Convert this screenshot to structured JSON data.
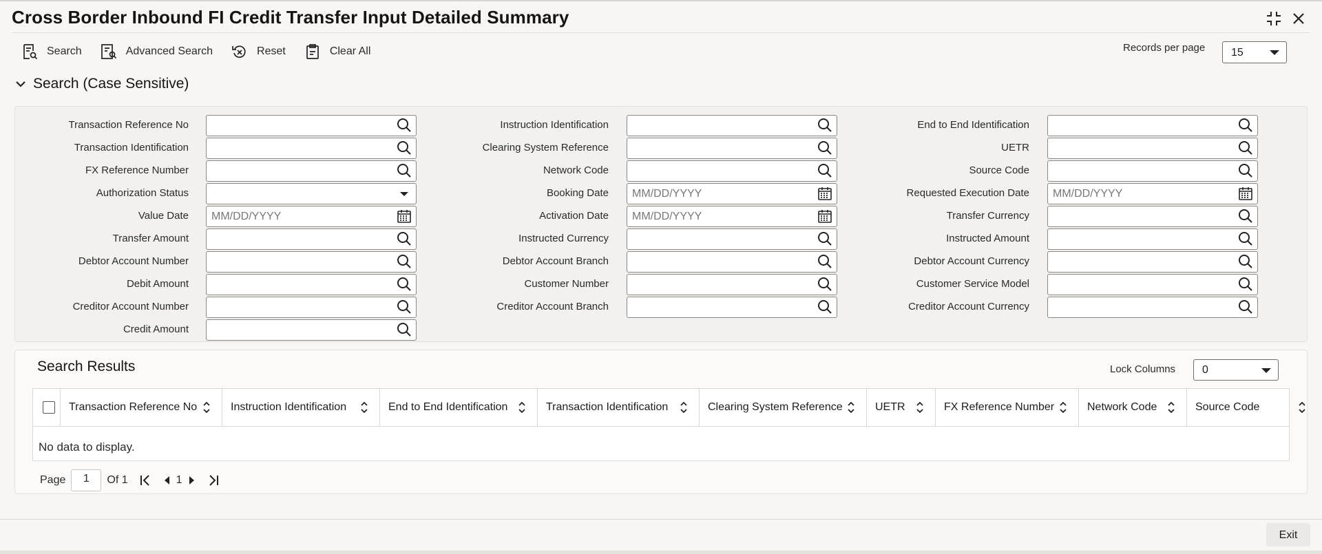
{
  "title": "Cross Border Inbound FI Credit Transfer Input Detailed Summary",
  "toolbar": {
    "search": "Search",
    "advanced_search": "Advanced Search",
    "reset": "Reset",
    "clear_all": "Clear All"
  },
  "records_per_page": {
    "label": "Records per page",
    "value": "15"
  },
  "search_section": {
    "title": "Search (Case Sensitive)"
  },
  "fields": {
    "col1": [
      {
        "label": "Transaction Reference No",
        "value": "",
        "placeholder": "",
        "icon": "search-icon"
      },
      {
        "label": "Transaction Identification",
        "value": "",
        "placeholder": "",
        "icon": "search-icon"
      },
      {
        "label": "FX Reference Number",
        "value": "",
        "placeholder": "",
        "icon": "search-icon"
      },
      {
        "label": "Authorization Status",
        "value": "",
        "placeholder": "",
        "icon": "dropdown-caret-icon"
      },
      {
        "label": "Value Date",
        "value": "",
        "placeholder": "MM/DD/YYYY",
        "icon": "calendar-icon"
      },
      {
        "label": "Transfer Amount",
        "value": "",
        "placeholder": "",
        "icon": "search-icon"
      },
      {
        "label": "Debtor Account Number",
        "value": "",
        "placeholder": "",
        "icon": "search-icon"
      },
      {
        "label": "Debit Amount",
        "value": "",
        "placeholder": "",
        "icon": "search-icon"
      },
      {
        "label": "Creditor Account Number",
        "value": "",
        "placeholder": "",
        "icon": "search-icon"
      },
      {
        "label": "Credit Amount",
        "value": "",
        "placeholder": "",
        "icon": "search-icon"
      }
    ],
    "col2": [
      {
        "label": "Instruction Identification",
        "value": "",
        "placeholder": "",
        "icon": "search-icon"
      },
      {
        "label": "Clearing System Reference",
        "value": "",
        "placeholder": "",
        "icon": "search-icon"
      },
      {
        "label": "Network Code",
        "value": "",
        "placeholder": "",
        "icon": "search-icon"
      },
      {
        "label": "Booking Date",
        "value": "",
        "placeholder": "MM/DD/YYYY",
        "icon": "calendar-icon"
      },
      {
        "label": "Activation Date",
        "value": "",
        "placeholder": "MM/DD/YYYY",
        "icon": "calendar-icon"
      },
      {
        "label": "Instructed Currency",
        "value": "",
        "placeholder": "",
        "icon": "search-icon"
      },
      {
        "label": "Debtor Account Branch",
        "value": "",
        "placeholder": "",
        "icon": "search-icon"
      },
      {
        "label": "Customer Number",
        "value": "",
        "placeholder": "",
        "icon": "search-icon"
      },
      {
        "label": "Creditor Account Branch",
        "value": "",
        "placeholder": "",
        "icon": "search-icon"
      }
    ],
    "col3": [
      {
        "label": "End to End Identification",
        "value": "",
        "placeholder": "",
        "icon": "search-icon"
      },
      {
        "label": "UETR",
        "value": "",
        "placeholder": "",
        "icon": "search-icon"
      },
      {
        "label": "Source Code",
        "value": "",
        "placeholder": "",
        "icon": "search-icon"
      },
      {
        "label": "Requested Execution Date",
        "value": "",
        "placeholder": "MM/DD/YYYY",
        "icon": "calendar-icon"
      },
      {
        "label": "Transfer Currency",
        "value": "",
        "placeholder": "",
        "icon": "search-icon"
      },
      {
        "label": "Instructed Amount",
        "value": "",
        "placeholder": "",
        "icon": "search-icon"
      },
      {
        "label": "Debtor Account Currency",
        "value": "",
        "placeholder": "",
        "icon": "search-icon"
      },
      {
        "label": "Customer Service Model",
        "value": "",
        "placeholder": "",
        "icon": "search-icon"
      },
      {
        "label": "Creditor Account Currency",
        "value": "",
        "placeholder": "",
        "icon": "search-icon"
      }
    ]
  },
  "results": {
    "title": "Search Results",
    "lock_columns": {
      "label": "Lock Columns",
      "value": "0"
    },
    "columns": [
      "Transaction Reference No",
      "Instruction Identification",
      "End to End Identification",
      "Transaction Identification",
      "Clearing System Reference",
      "UETR",
      "FX Reference Number",
      "Network Code",
      "Source Code"
    ],
    "empty_text": "No data to display."
  },
  "pagination": {
    "page_label": "Page",
    "page_value": "1",
    "of_label": "Of 1",
    "current": "1"
  },
  "footer": {
    "exit": "Exit"
  }
}
